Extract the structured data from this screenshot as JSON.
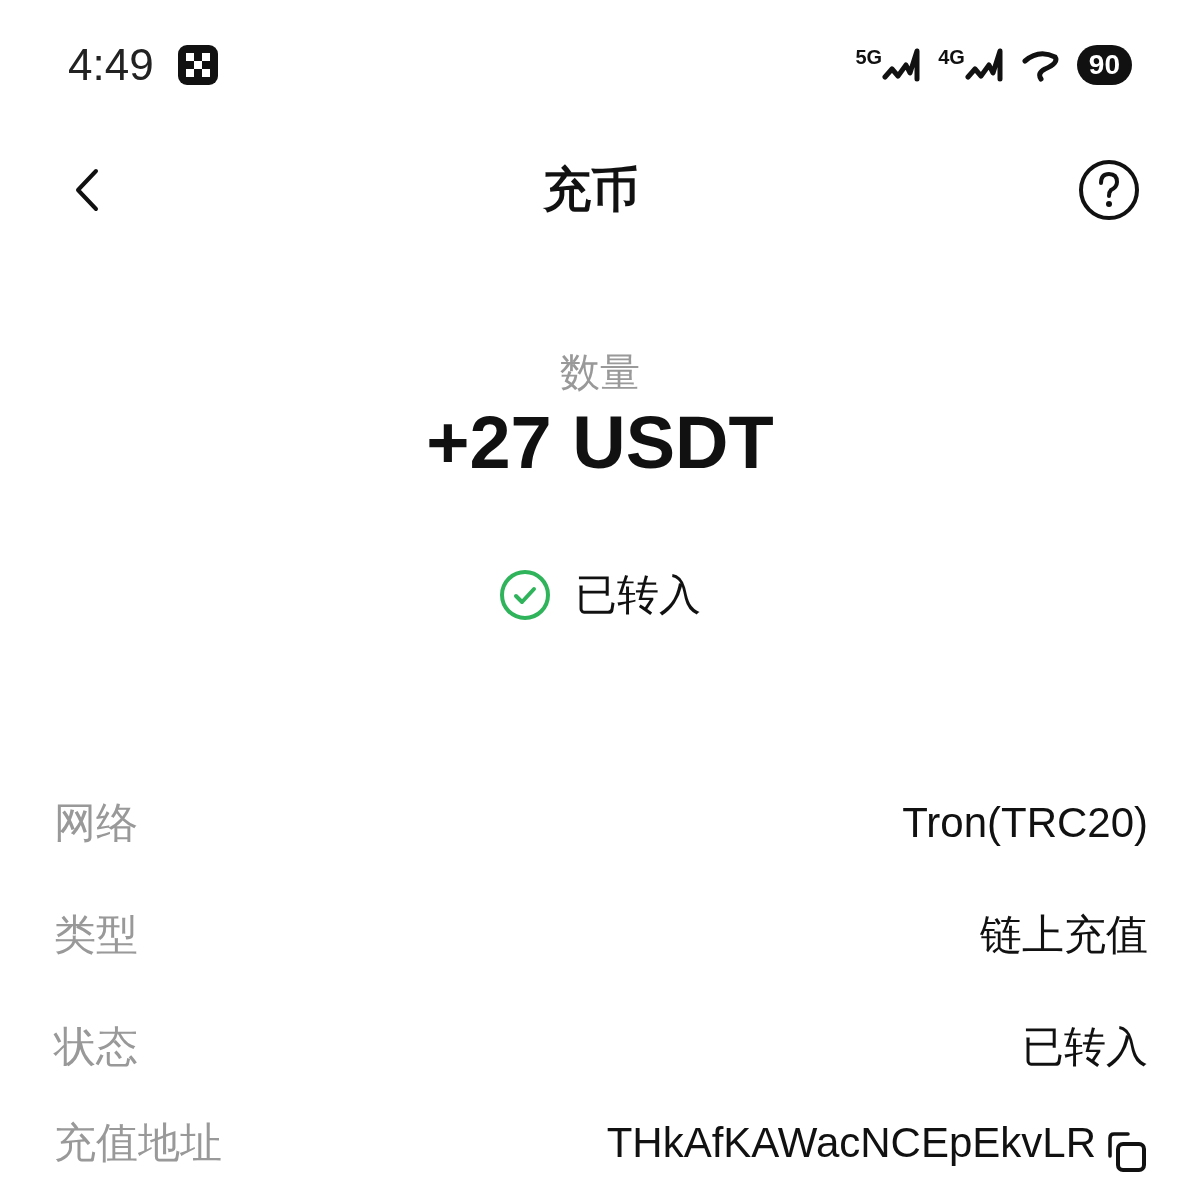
{
  "status_bar": {
    "time": "4:49",
    "signals": [
      {
        "label": "5G"
      },
      {
        "label": "4G"
      }
    ],
    "battery": "90"
  },
  "header": {
    "title": "充币"
  },
  "amount": {
    "label": "数量",
    "value": "+27 USDT"
  },
  "status": {
    "text": "已转入",
    "done": true
  },
  "details": [
    {
      "label": "网络",
      "value": "Tron(TRC20)",
      "copyable": false
    },
    {
      "label": "类型",
      "value": "链上充值",
      "copyable": false
    },
    {
      "label": "状态",
      "value": "已转入",
      "copyable": false
    },
    {
      "label": "充值地址",
      "value": "THkAfKAWacNCEpEkvLR",
      "copyable": true
    }
  ]
}
